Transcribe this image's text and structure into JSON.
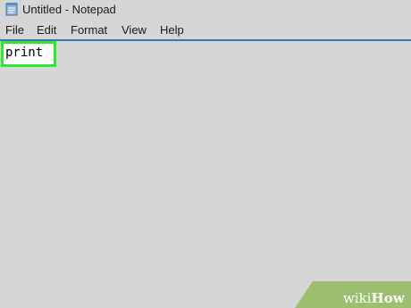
{
  "window": {
    "title": "Untitled - Notepad",
    "icon": "notepad-icon"
  },
  "menu": {
    "items": [
      {
        "label": "File"
      },
      {
        "label": "Edit"
      },
      {
        "label": "Format"
      },
      {
        "label": "View"
      },
      {
        "label": "Help"
      }
    ]
  },
  "editor": {
    "text": "print",
    "highlight_color": "#2ee82e"
  },
  "watermark": {
    "part1": "wiki",
    "part2": "How"
  },
  "colors": {
    "background": "#d6d6d6",
    "menu_separator": "#3b76b3"
  }
}
